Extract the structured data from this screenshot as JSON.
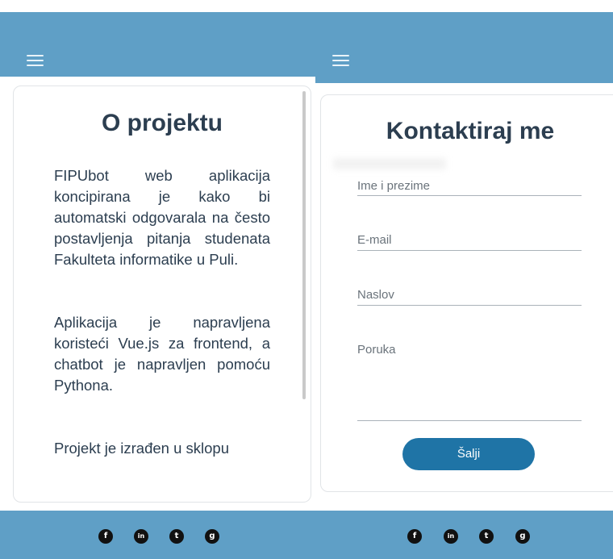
{
  "about_page": {
    "title": "O projektu",
    "paragraphs": [
      "FIPUbot web aplikacija koncipirana je kako bi automatski odgovarala na često postavljenja pitanja studenata Fakulteta informatike u Puli.",
      "Aplikacija je napravljena koristeći Vue.js za frontend, a chatbot je napravljen pomoću Pythona.",
      "Projekt je izrađen u sklopu"
    ]
  },
  "contact_page": {
    "title": "Kontaktiraj me",
    "fields": {
      "name_placeholder": "Ime i prezime",
      "email_placeholder": "E-mail",
      "subject_placeholder": "Naslov",
      "message_placeholder": "Poruka"
    },
    "send_label": "Šalji"
  },
  "header": {
    "menu_icon": "hamburger-menu-icon"
  },
  "footer": {
    "social_icons": [
      {
        "name": "facebook-icon",
        "glyph": "f"
      },
      {
        "name": "linkedin-icon",
        "glyph": "in"
      },
      {
        "name": "twitter-icon",
        "glyph": "t"
      },
      {
        "name": "github-icon",
        "glyph": "g"
      }
    ]
  },
  "colors": {
    "header_bg": "#5f9fc6",
    "button_bg": "#1f74a6",
    "title_text": "#2c3e50"
  }
}
